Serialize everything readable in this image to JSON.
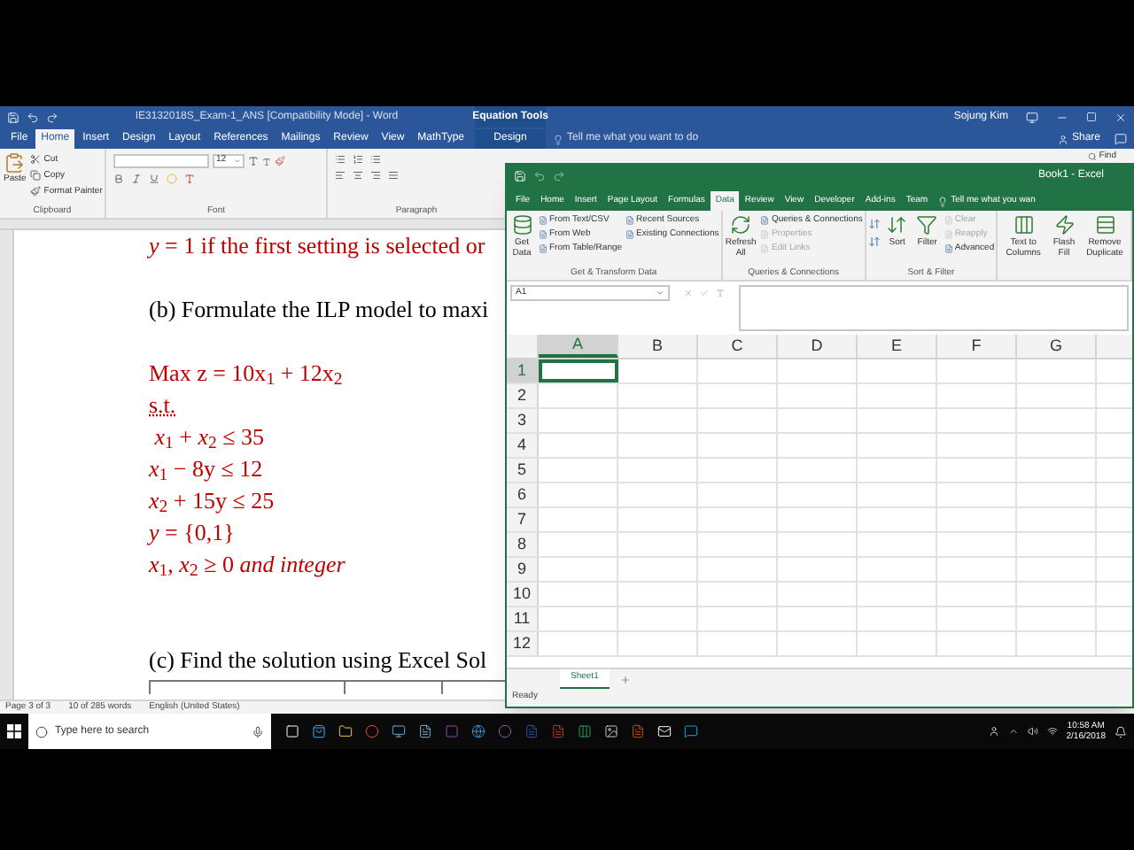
{
  "word": {
    "title": "IE3132018S_Exam-1_ANS [Compatibility Mode] - Word",
    "context_group": "Equation Tools",
    "user": "Sojung Kim",
    "tabs": [
      {
        "label": "File",
        "selected": false
      },
      {
        "label": "Home",
        "selected": true
      },
      {
        "label": "Insert",
        "selected": false
      },
      {
        "label": "Design",
        "selected": false
      },
      {
        "label": "Layout",
        "selected": false
      },
      {
        "label": "References",
        "selected": false
      },
      {
        "label": "Mailings",
        "selected": false
      },
      {
        "label": "Review",
        "selected": false
      },
      {
        "label": "View",
        "selected": false
      },
      {
        "label": "MathType",
        "selected": false
      }
    ],
    "context_tab": {
      "label": "Design",
      "selected": false
    },
    "tell_me": "Tell me what you want to do",
    "share": "Share",
    "clipboard": {
      "paste": "Paste",
      "items": [
        "Cut",
        "Copy",
        "Format Painter"
      ],
      "label": "Clipboard"
    },
    "font": {
      "size": "12",
      "label": "Font"
    },
    "paragraph": {
      "label": "Paragraph"
    },
    "find": "Find",
    "lines": [
      {
        "kind": "math",
        "text": "*y* = 1 if the first setting is selected or"
      },
      {
        "kind": "blank"
      },
      {
        "kind": "text",
        "text": "(b) Formulate the ILP model to maxi"
      },
      {
        "kind": "blank"
      },
      {
        "kind": "math",
        "text": "Max z = 10x$_{1}$ + 12x$_{2}$"
      },
      {
        "kind": "flagged",
        "text": "s.t."
      },
      {
        "kind": "math",
        "text": " *x*$_{1}$ + *x*$_{2}$ ≤ 35"
      },
      {
        "kind": "math",
        "text": "*x*$_{1}$ − 8y ≤ 12"
      },
      {
        "kind": "math",
        "text": "*x*$_{2}$ + 15y ≤ 25"
      },
      {
        "kind": "math",
        "text": "*y* = {0,1}"
      },
      {
        "kind": "math",
        "text": "*x*$_{1}$, *x*$_{2}$ ≥ 0 *and integer*"
      },
      {
        "kind": "blank"
      },
      {
        "kind": "blank"
      },
      {
        "kind": "text",
        "text": "(c) Find the solution using Excel Sol"
      }
    ],
    "status": [
      "Page 3 of 3",
      "10 of 285 words",
      "English (United States)"
    ]
  },
  "excel": {
    "title": "Book1 - Excel",
    "tabs": [
      {
        "label": "File",
        "selected": false
      },
      {
        "label": "Home",
        "selected": false
      },
      {
        "label": "Insert",
        "selected": false
      },
      {
        "label": "Page Layout",
        "selected": false
      },
      {
        "label": "Formulas",
        "selected": false
      },
      {
        "label": "Data",
        "selected": true
      },
      {
        "label": "Review",
        "selected": false
      },
      {
        "label": "View",
        "selected": false
      },
      {
        "label": "Developer",
        "selected": false
      },
      {
        "label": "Add-ins",
        "selected": false
      },
      {
        "label": "Team",
        "selected": false
      }
    ],
    "tell_me": "Tell me what you wan",
    "groups": [
      {
        "label": "Get & Transform Data",
        "items": [
          {
            "kind": "large",
            "label": "Get Data",
            "disabled": false
          },
          {
            "kind": "small",
            "label": "From Text/CSV",
            "disabled": false
          },
          {
            "kind": "small",
            "label": "From Web",
            "disabled": false
          },
          {
            "kind": "small",
            "label": "From Table/Range",
            "disabled": false
          },
          {
            "kind": "small",
            "label": "Recent Sources",
            "disabled": false
          },
          {
            "kind": "small",
            "label": "Existing Connections",
            "disabled": false
          }
        ]
      },
      {
        "label": "Queries & Connections",
        "items": [
          {
            "kind": "large",
            "label": "Refresh All",
            "disabled": false
          },
          {
            "kind": "small",
            "label": "Queries & Connections",
            "disabled": false
          },
          {
            "kind": "small",
            "label": "Properties",
            "disabled": true
          },
          {
            "kind": "small",
            "label": "Edit Links",
            "disabled": true
          }
        ]
      },
      {
        "label": "Sort & Filter",
        "items": [
          {
            "kind": "sort_pair",
            "disabled": false
          },
          {
            "kind": "large",
            "label": "Sort",
            "disabled": false
          },
          {
            "kind": "large",
            "label": "Filter",
            "disabled": false
          },
          {
            "kind": "small",
            "label": "Clear",
            "disabled": true
          },
          {
            "kind": "small",
            "label": "Reapply",
            "disabled": true
          },
          {
            "kind": "small",
            "label": "Advanced",
            "disabled": false
          }
        ]
      },
      {
        "items": [
          {
            "kind": "large",
            "label": "Text to Columns",
            "disabled": false
          },
          {
            "kind": "large",
            "label": "Flash Fill",
            "disabled": false
          },
          {
            "kind": "large",
            "label": "Remove Duplicate",
            "disabled": false
          }
        ]
      }
    ],
    "name_box": "A1",
    "columns": [
      {
        "label": "A",
        "selected": true
      },
      {
        "label": "B",
        "selected": false
      },
      {
        "label": "C",
        "selected": false
      },
      {
        "label": "D",
        "selected": false
      },
      {
        "label": "E",
        "selected": false
      },
      {
        "label": "F",
        "selected": false
      },
      {
        "label": "G",
        "selected": false
      }
    ],
    "rows": [
      {
        "label": "1",
        "selected": true
      },
      {
        "label": "2",
        "selected": false
      },
      {
        "label": "3",
        "selected": false
      },
      {
        "label": "4",
        "selected": false
      },
      {
        "label": "5",
        "selected": false
      },
      {
        "label": "6",
        "selected": false
      },
      {
        "label": "7",
        "selected": false
      },
      {
        "label": "8",
        "selected": false
      },
      {
        "label": "9",
        "selected": false
      },
      {
        "label": "10",
        "selected": false
      },
      {
        "label": "11",
        "selected": false
      },
      {
        "label": "12",
        "selected": false
      }
    ],
    "sheets": [
      {
        "label": "Sheet1",
        "selected": true
      }
    ],
    "status": "Ready"
  },
  "taskbar": {
    "search_placeholder": "Type here to search",
    "time": "10:58 AM",
    "date": "2/16/2018"
  }
}
